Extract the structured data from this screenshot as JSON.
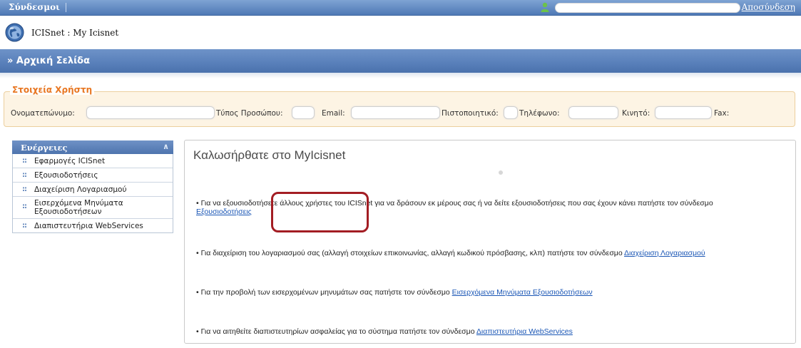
{
  "topbar": {
    "links_label": "Σύνδεσμοι",
    "logout_label": "Αποσύνδεση"
  },
  "app": {
    "title": "ICISnet : My Icisnet"
  },
  "home": {
    "title": "» Αρχική Σελίδα"
  },
  "user_details": {
    "legend": "Στοιχεία Χρήστη",
    "fields": [
      {
        "label": "Ονοματεπώνυμο:",
        "value": ""
      },
      {
        "label": "Τύπος Προσώπου:",
        "value": ""
      },
      {
        "label": "Email:",
        "value": ""
      },
      {
        "label": "Πιστοποιητικό:",
        "value": ""
      },
      {
        "label": "Τηλέφωνο:",
        "value": ""
      },
      {
        "label": "Κινητό:",
        "value": ""
      },
      {
        "label": "Fax:",
        "value": ""
      }
    ]
  },
  "sidebar": {
    "title": "Ενέργειες",
    "items": [
      {
        "label": "Εφαρμογές ICISnet"
      },
      {
        "label": "Εξουσιοδοτήσεις"
      },
      {
        "label": "Διαχείριση Λογαριασμού"
      },
      {
        "label": "Εισερχόμενα Μηνύματα Εξουσιοδοτήσεων"
      },
      {
        "label": "Διαπιστευτήρια WebServices"
      }
    ]
  },
  "main": {
    "welcome": "Καλωσήρθατε στο MyIcisnet",
    "p1_text": "• Για να εξουσιοδοτήσετε άλλους χρήστες του ICISnet για να δράσουν εκ μέρους σας ή να δείτε εξουσιοδοτήσεις που σας έχουν κάνει πατήστε τον σύνδεσμο ",
    "p1_link": "Εξουσιοδοτήσεις",
    "p2_text": "• Για διαχείριση του λογαριασμού σας (αλλαγή στοιχείων επικοινωνίας, αλλαγή κωδικού πρόσβασης, κλπ) πατήστε τον σύνδεσμο ",
    "p2_link": "Διαχείριση Λογαριασμού",
    "p3_text": "• Για την προβολή των εισερχομένων μηνυμάτων σας πατήστε τον σύνδεσμο ",
    "p3_link": "Εισερχόμενα Μηνύματα Εξουσιοδοτήσεων",
    "p4_text": "• Για να αιτηθείτε διαπιστευτηρίων ασφαλείας για το σύστημα πατήστε τον σύνδεσμο ",
    "p4_link": "Διαπιστευτήρια WebServices"
  },
  "colors": {
    "header_blue": "#5a81bb",
    "legend_orange": "#e87722",
    "link_blue": "#1a56b5",
    "highlight_red": "#a31d23"
  }
}
